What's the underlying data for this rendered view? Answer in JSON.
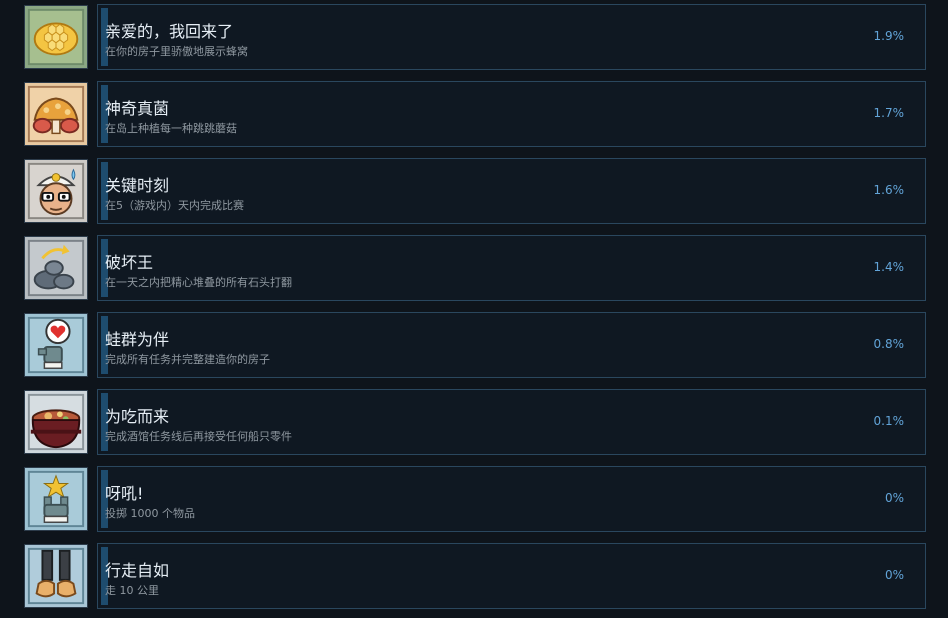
{
  "achievements": [
    {
      "title": "亲爱的，我回来了",
      "desc": "在你的房子里骄傲地展示蜂窝",
      "percent": "1.9%",
      "percent_value": 1.9,
      "icon": "honeycomb-icon",
      "icon_bg": "#8ba884"
    },
    {
      "title": "神奇真菌",
      "desc": "在岛上种植每一种跳跳蘑菇",
      "percent": "1.7%",
      "percent_value": 1.7,
      "icon": "mushroom-icon",
      "icon_bg": "#e8c9a0"
    },
    {
      "title": "关键时刻",
      "desc": "在5（游戏内）天内完成比赛",
      "percent": "1.6%",
      "percent_value": 1.6,
      "icon": "captain-icon",
      "icon_bg": "#cdcac6"
    },
    {
      "title": "破坏王",
      "desc": "在一天之内把精心堆叠的所有石头打翻",
      "percent": "1.4%",
      "percent_value": 1.4,
      "icon": "rocks-icon",
      "icon_bg": "#b8bec2"
    },
    {
      "title": "蛙群为伴",
      "desc": "完成所有任务并完整建造你的房子",
      "percent": "0.8%",
      "percent_value": 0.8,
      "icon": "heart-frog-icon",
      "icon_bg": "#9ec3d3"
    },
    {
      "title": "为吃而来",
      "desc": "完成酒馆任务线后再接受任何船只零件",
      "percent": "0.1%",
      "percent_value": 0.1,
      "icon": "stew-pot-icon",
      "icon_bg": "#cfd7dc"
    },
    {
      "title": "呀吼!",
      "desc": "投掷 1000 个物品",
      "percent": "0%",
      "percent_value": 0,
      "icon": "star-throw-icon",
      "icon_bg": "#9ec3d3"
    },
    {
      "title": "行走自如",
      "desc": "走 10 公里",
      "percent": "0%",
      "percent_value": 0,
      "icon": "legs-icon",
      "icon_bg": "#a9c6d6"
    }
  ]
}
